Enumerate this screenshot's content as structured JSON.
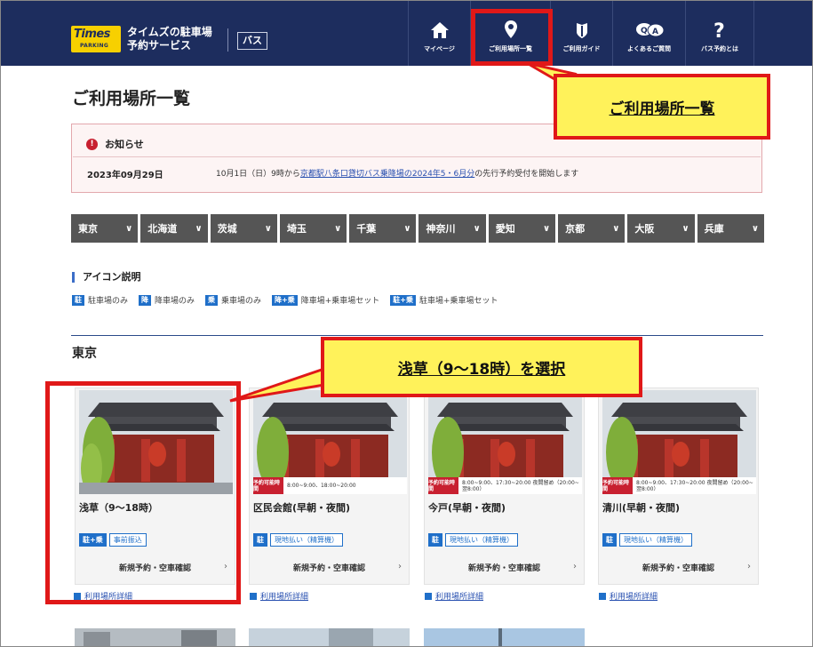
{
  "header": {
    "logo_text": "Times",
    "logo_sub": "PARKING",
    "service_line1": "タイムズの駐車場",
    "service_line2": "予約サービス",
    "bus_badge": "バス",
    "nav": [
      {
        "label": "マイページ",
        "icon": "home-icon"
      },
      {
        "label": "ご利用場所一覧",
        "icon": "location-pin-icon"
      },
      {
        "label": "ご利用ガイド",
        "icon": "guide-shield-icon"
      },
      {
        "label": "よくあるご質問",
        "icon": "faq-qa-icon"
      },
      {
        "label": "バス予約とは",
        "icon": "question-mark-icon"
      }
    ]
  },
  "page_title": "ご利用場所一覧",
  "notice": {
    "heading": "お知らせ",
    "date": "2023年09月29日",
    "msg_before": "10月1日（日）9時から",
    "msg_link": "京都駅八条口貸切バス乗降場の2024年5・6月分",
    "msg_after": "の先行予約受付を開始します"
  },
  "prefectures": [
    "東京",
    "北海道",
    "茨城",
    "埼玉",
    "千葉",
    "神奈川",
    "愛知",
    "京都",
    "大阪",
    "兵庫"
  ],
  "legend": {
    "title": "アイコン説明",
    "items": [
      {
        "tag": "駐",
        "text": "駐車場のみ"
      },
      {
        "tag": "降",
        "text": "降車場のみ"
      },
      {
        "tag": "乗",
        "text": "乗車場のみ"
      },
      {
        "tag": "降+乗",
        "text": "降車場+乗車場セット"
      },
      {
        "tag": "駐+乗",
        "text": "駐車場+乗車場セット"
      }
    ]
  },
  "section_title": "東京",
  "cards": [
    {
      "name": "浅草（9〜18時）",
      "tag": "駐+乗",
      "payment": "事前振込",
      "button": "新規予約・空車確認",
      "detail": "利用場所詳細",
      "time_head": "",
      "time_value": ""
    },
    {
      "name": "区民会館(早朝・夜間)",
      "tag": "駐",
      "payment": "現地払い（精算機）",
      "button": "新規予約・空車確認",
      "detail": "利用場所詳細",
      "time_head": "予約可能時間",
      "time_value": "8:00~9:00、18:00~20:00"
    },
    {
      "name": "今戸(早朝・夜間)",
      "tag": "駐",
      "payment": "現地払い（精算機）",
      "button": "新規予約・空車確認",
      "detail": "利用場所詳細",
      "time_head": "予約可能時間",
      "time_value": "8:00~9:00、17:30~20:00 夜間留め（20:00~翌8:00）"
    },
    {
      "name": "清川(早朝・夜間)",
      "tag": "駐",
      "payment": "現地払い（精算機）",
      "button": "新規予約・空車確認",
      "detail": "利用場所詳細",
      "time_head": "予約可能時間",
      "time_value": "8:00~9:00、17:30~20:00 夜間留め（20:00~翌8:00）"
    }
  ],
  "annotations": {
    "nav_callout": "ご利用場所一覧",
    "card_callout": "浅草（9～18時）を選択"
  },
  "colors": {
    "header": "#1d2d5e",
    "accent_red": "#e01818",
    "callout_yellow": "#fff25a",
    "tag_blue": "#1f6fc9"
  }
}
